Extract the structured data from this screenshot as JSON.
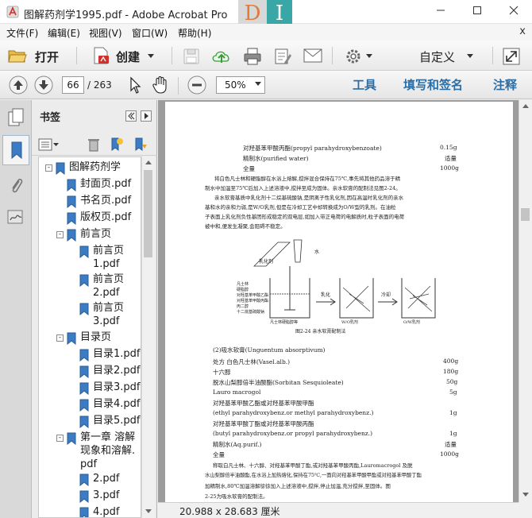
{
  "window": {
    "title": "图解药剂学1995.pdf - Adobe Acrobat Pro",
    "brand_letters": [
      "D",
      "I"
    ],
    "accent": "#2b6ea6",
    "minimize_icon": "minimize-icon",
    "maximize_icon": "maximize-icon",
    "close_icon": "close-icon"
  },
  "menu": {
    "items": [
      "文件(F)",
      "编辑(E)",
      "视图(V)",
      "窗口(W)",
      "帮助(H)"
    ],
    "close_glyph": "x"
  },
  "toolbar": {
    "open_label": "打开",
    "create_label": "创建",
    "customize_label": "自定义",
    "page_current": "66",
    "page_total": "/ 263",
    "zoom": "50%",
    "tasks": [
      "工具",
      "填写和签名",
      "注释"
    ]
  },
  "panel": {
    "title": "书签"
  },
  "bookmarks": [
    {
      "level": 0,
      "expander": "-",
      "text": "图解药剂学"
    },
    {
      "level": 1,
      "expander": "",
      "text": "封面页.pdf"
    },
    {
      "level": 1,
      "expander": "",
      "text": "书名页.pdf"
    },
    {
      "level": 1,
      "expander": "",
      "text": "版权页.pdf"
    },
    {
      "level": 1,
      "expander": "-",
      "text": "前言页"
    },
    {
      "level": 2,
      "expander": "",
      "text": "前言页1.pdf"
    },
    {
      "level": 2,
      "expander": "",
      "text": "前言页2.pdf"
    },
    {
      "level": 2,
      "expander": "",
      "text": "前言页3.pdf"
    },
    {
      "level": 1,
      "expander": "-",
      "text": "目录页"
    },
    {
      "level": 2,
      "expander": "",
      "text": "目录1.pdf"
    },
    {
      "level": 2,
      "expander": "",
      "text": "目录2.pdf"
    },
    {
      "level": 2,
      "expander": "",
      "text": "目录3.pdf"
    },
    {
      "level": 2,
      "expander": "",
      "text": "目录4.pdf"
    },
    {
      "level": 2,
      "expander": "",
      "text": "目录5.pdf"
    },
    {
      "level": 1,
      "expander": "-",
      "text": "第一章 溶解现象和溶解.pdf"
    },
    {
      "level": 2,
      "expander": "",
      "text": "2.pdf"
    },
    {
      "level": 2,
      "expander": "",
      "text": "3.pdf"
    },
    {
      "level": 2,
      "expander": "",
      "text": "4.pdf"
    }
  ],
  "document": {
    "lines": [
      {
        "text": "对羟基苯甲酸丙酯(propyl parahydroxybenzoate)",
        "right": "0.15g"
      },
      {
        "text": "精制水(purified water)",
        "right": "适量"
      },
      {
        "text": "全量",
        "right": "1000g"
      },
      {
        "text": "将白色凡士林和硬脂醇在水浴上熔解,搅拌混合保持在75℃,事先将其他药品溶于精",
        "right": ""
      },
      {
        "text": "制水中加温至75℃后加入上述溶液中,搅拌至成为固体。亲水软膏的配制法见图2-24。",
        "right": ""
      },
      {
        "text": "亲水软膏基质中乳化剂十二烷基硫酸钠,是阴离子性乳化剂,因在高温时乳化剂的亲水",
        "right": ""
      },
      {
        "text": "基和水的亲和力弱,是W/O乳剂,但是在冷却工艺中却转换成为O/W型的乳剂。在油粒",
        "right": ""
      },
      {
        "text": "子表面上乳化剂负性基团形成稳定的双电层,如加入带正电荷的电解质时,粒子表面的电荷",
        "right": ""
      },
      {
        "text": "被中和,便发生凝聚,会阻碍不稳定。",
        "right": ""
      }
    ],
    "figure_labels": {
      "water_label": "水",
      "emulsifier_label": "乳化剂",
      "step1": "乳化",
      "step2": "冷却",
      "left_list": [
        "凡士林",
        "硬脂醇",
        "对羟基苯甲酸乙酯",
        "对羟基苯甲酸丙酯",
        "丙二醇",
        "十二烷基硫酸钠"
      ],
      "beaker_labels": [
        "凡士林硬脂醇等",
        "W/O乳剂",
        "O/W乳剂"
      ],
      "caption": "图2-24  亲水软膏配制法"
    },
    "section2": [
      {
        "text": "(2)吸水软膏(Unguentum absorptivum)",
        "right": ""
      },
      {
        "text": "处方    白色凡士林(Vasel.alb.)",
        "right": "400g"
      },
      {
        "text": "十六醇",
        "right": "180g"
      },
      {
        "text": "脱水山梨醇倍半油酸酯(Sorbitan Sesquioleate)",
        "right": "50g"
      },
      {
        "text": "Lauro macrogol",
        "right": "5g"
      },
      {
        "text": "对羟基苯甲酸乙酯或对羟基苯甲酸甲酯",
        "right": ""
      },
      {
        "text": "(ethyl parahydroxybenz.or methyl parahydroxybenz.)",
        "right": "1g"
      },
      {
        "text": "对羟基苯甲酸丁酯或对羟基苯甲酸丙酯",
        "right": ""
      },
      {
        "text": "(butyl parahydroxybenz.or propyl parahydroxybenz.)",
        "right": "1g"
      },
      {
        "text": "精制水(Aq.purif.)",
        "right": "适量"
      },
      {
        "text": "全量",
        "right": "1000g"
      },
      {
        "text": "称取白凡士林、十六醇、对羟基苯甲酸丁酯,或对羟基苯甲酸丙酯,Lauromacrogol 及脱",
        "right": ""
      },
      {
        "text": "水山梨醇倍半油酸酯,在水浴上加热熔化,保持在75℃,一面向对羟基苯甲酸甲酯或对羟基苯甲酸丁酯",
        "right": ""
      },
      {
        "text": "加精制水,80℃加温溶解徐徐加入上述溶液中,搅拌,停止加温,充分搅拌,至固体。图",
        "right": ""
      },
      {
        "text": "2-25为吸水软膏的配制法。",
        "right": ""
      }
    ]
  },
  "status": {
    "dimensions": "20.988 x 28.683 厘米"
  }
}
